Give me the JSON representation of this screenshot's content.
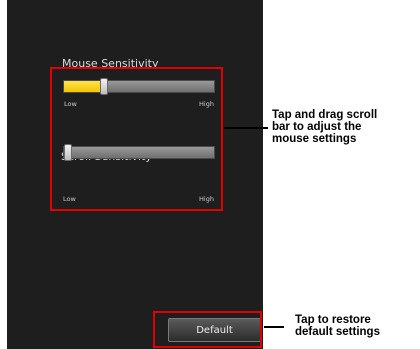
{
  "settings": {
    "mouse_label": "Mouse Sensitivity",
    "mouse_value": 0.25,
    "mouse_low": "Low",
    "mouse_high": "High",
    "scroll_label": "Scroll Sensitivity",
    "scroll_value": 0.0,
    "scroll_low": "Low",
    "scroll_high": "High",
    "default_button": "Default"
  },
  "callouts": {
    "drag": "Tap and drag scroll\nbar to adjust the\nmouse settings",
    "restore": "Tap to restore\ndefault settings"
  },
  "colors": {
    "highlight": "#e00000",
    "slider_fill": "#f2c600",
    "screen_bg": "#1e1e1e"
  }
}
